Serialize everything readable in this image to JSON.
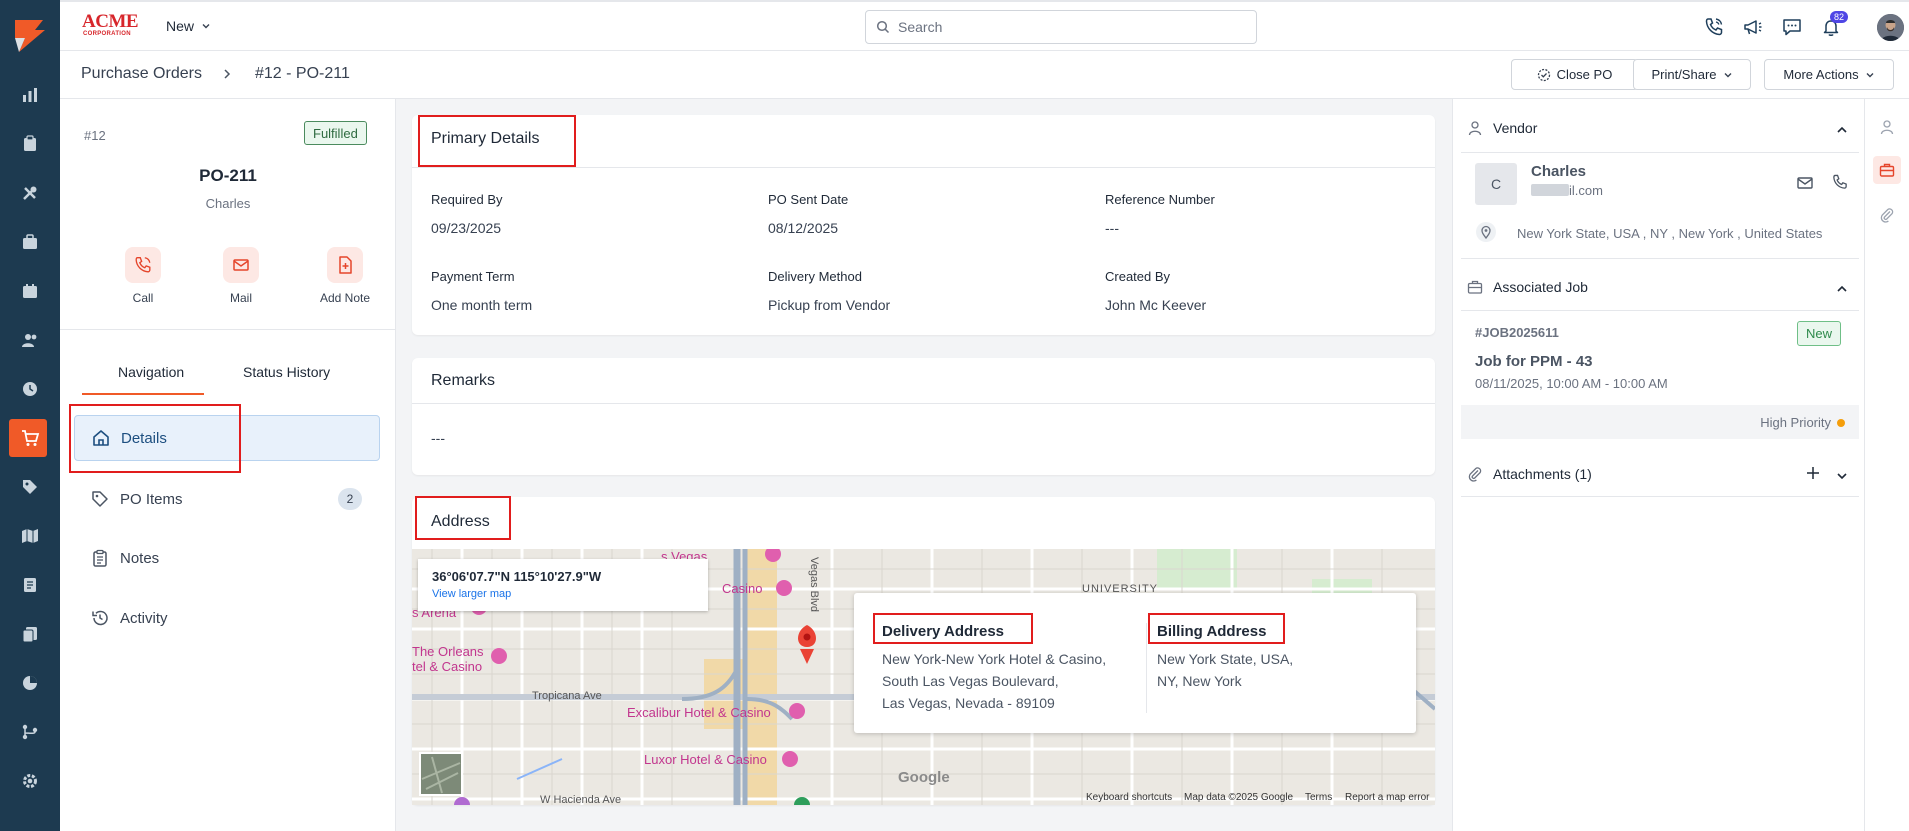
{
  "app": {
    "brand_name": "ACME",
    "brand_sub": "CORPORATION"
  },
  "topbar": {
    "new_label": "New",
    "search_placeholder": "Search",
    "notification_count": "82"
  },
  "breadcrumb": {
    "parent": "Purchase Orders",
    "current": "#12 - PO-211"
  },
  "actions": {
    "close_po": "Close PO",
    "print_share": "Print/Share",
    "more_actions": "More Actions"
  },
  "summary": {
    "number": "#12",
    "status": "Fulfilled",
    "po_code": "PO-211",
    "vendor": "Charles",
    "quick_actions": {
      "call": "Call",
      "mail": "Mail",
      "add_note": "Add Note"
    }
  },
  "tabs": {
    "navigation": "Navigation",
    "status_history": "Status History"
  },
  "nav": {
    "details": "Details",
    "po_items": "PO Items",
    "po_items_count": "2",
    "notes": "Notes",
    "activity": "Activity"
  },
  "primary": {
    "title": "Primary Details",
    "required_by_label": "Required By",
    "required_by": "09/23/2025",
    "po_sent_label": "PO Sent Date",
    "po_sent": "08/12/2025",
    "ref_label": "Reference Number",
    "ref": "---",
    "payment_label": "Payment Term",
    "payment": "One month term",
    "delivery_label": "Delivery Method",
    "delivery": "Pickup from Vendor",
    "created_label": "Created By",
    "created": "John Mc Keever"
  },
  "remarks": {
    "title": "Remarks",
    "value": "---"
  },
  "address": {
    "title": "Address",
    "coordinates": "36°06'07.7\"N 115°10'27.9\"W",
    "view_larger_map": "View larger map",
    "delivery_title": "Delivery Address",
    "delivery_line1": "New York-New York Hotel & Casino,",
    "delivery_line2": "South Las Vegas Boulevard,",
    "delivery_line3": "Las Vegas, Nevada - 89109",
    "billing_title": "Billing Address",
    "billing_line1": "New York State, USA,",
    "billing_line2": "NY, New York"
  },
  "map_labels": {
    "las_vegas": "s Vegas",
    "casino": "Casino",
    "arena": "s Arena",
    "orleans": "The Orleans",
    "orleans2": "tel & Casino",
    "tropicana": "Tropicana Ave",
    "excalibur": "Excalibur Hotel & Casino",
    "luxor": "Luxor Hotel & Casino",
    "hacienda": "W Hacienda Ave",
    "vegas_blvd": "Vegas Blvd",
    "university": "UNIVERSITY",
    "google": "Google",
    "keyboard": "Keyboard shortcuts",
    "map_data": "Map data ©2025 Google",
    "terms": "Terms",
    "report": "Report a map error"
  },
  "vendor_panel": {
    "title": "Vendor",
    "initial": "C",
    "name": "Charles",
    "email_visible": "il.com",
    "address": "New York State, USA , NY , New York , United States"
  },
  "job_panel": {
    "title": "Associated Job",
    "job_id": "#JOB2025611",
    "status": "New",
    "job_title": "Job for PPM - 43",
    "time": "08/11/2025, 10:00 AM - 10:00 AM",
    "priority": "High Priority"
  },
  "attachments": {
    "title": "Attachments (1)"
  },
  "colors": {
    "accent": "#f05a28",
    "rail": "#1d3a50",
    "highlight": "#e11d1d",
    "link": "#1a73e8"
  }
}
